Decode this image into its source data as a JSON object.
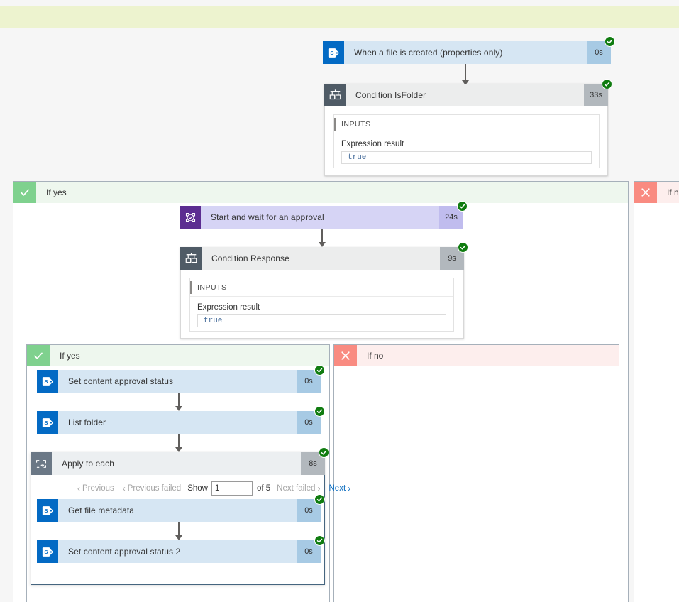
{
  "banner": {
    "text": ""
  },
  "flow": {
    "trigger": {
      "name": "When a file is created (properties only)",
      "duration": "0s",
      "icon": "sharepoint-icon",
      "status": "succeeded"
    },
    "condition_isfolder": {
      "name": "Condition IsFolder",
      "duration": "33s",
      "icon": "condition-icon",
      "status": "succeeded",
      "details": {
        "section_label": "INPUTS",
        "field_label": "Expression result",
        "value": "true"
      }
    },
    "branch_yes_outer": {
      "label": "If yes",
      "icon": "check-icon"
    },
    "branch_no_outer": {
      "label": "If no",
      "icon": "cross-icon"
    },
    "approval": {
      "name": "Start and wait for an approval",
      "duration": "24s",
      "icon": "approval-icon",
      "status": "succeeded"
    },
    "condition_response": {
      "name": "Condition Response",
      "duration": "9s",
      "icon": "condition-icon",
      "status": "succeeded",
      "details": {
        "section_label": "INPUTS",
        "field_label": "Expression result",
        "value": "true"
      }
    },
    "branch_yes_inner": {
      "label": "If yes",
      "icon": "check-icon"
    },
    "branch_no_inner": {
      "label": "If no",
      "icon": "cross-icon"
    },
    "set_approval_status": {
      "name": "Set content approval status",
      "duration": "0s",
      "icon": "sharepoint-icon",
      "status": "succeeded"
    },
    "list_folder": {
      "name": "List folder",
      "duration": "0s",
      "icon": "sharepoint-icon",
      "status": "succeeded"
    },
    "apply_to_each": {
      "name": "Apply to each",
      "duration": "8s",
      "icon": "foreach-icon",
      "status": "succeeded",
      "pager": {
        "previous": "Previous",
        "previous_failed": "Previous failed",
        "show_label": "Show",
        "page_value": "1",
        "of_label": "of 5",
        "next_failed": "Next failed",
        "next": "Next"
      }
    },
    "get_file_metadata": {
      "name": "Get file metadata",
      "duration": "0s",
      "icon": "sharepoint-icon",
      "status": "succeeded"
    },
    "set_approval_status_2": {
      "name": "Set content approval status 2",
      "duration": "0s",
      "icon": "sharepoint-icon",
      "status": "succeeded"
    }
  },
  "colors": {
    "sharepoint_blue": "#036ac4",
    "sharepoint_card": "#d6e6f3",
    "condition_gray": "#4f5b66",
    "approval_purple": "#5c2d91",
    "success_green": "#107c10",
    "branch_yes_green": "#7fd18e",
    "branch_no_red": "#f98b81",
    "banner_yellow": "#edf3cf"
  }
}
